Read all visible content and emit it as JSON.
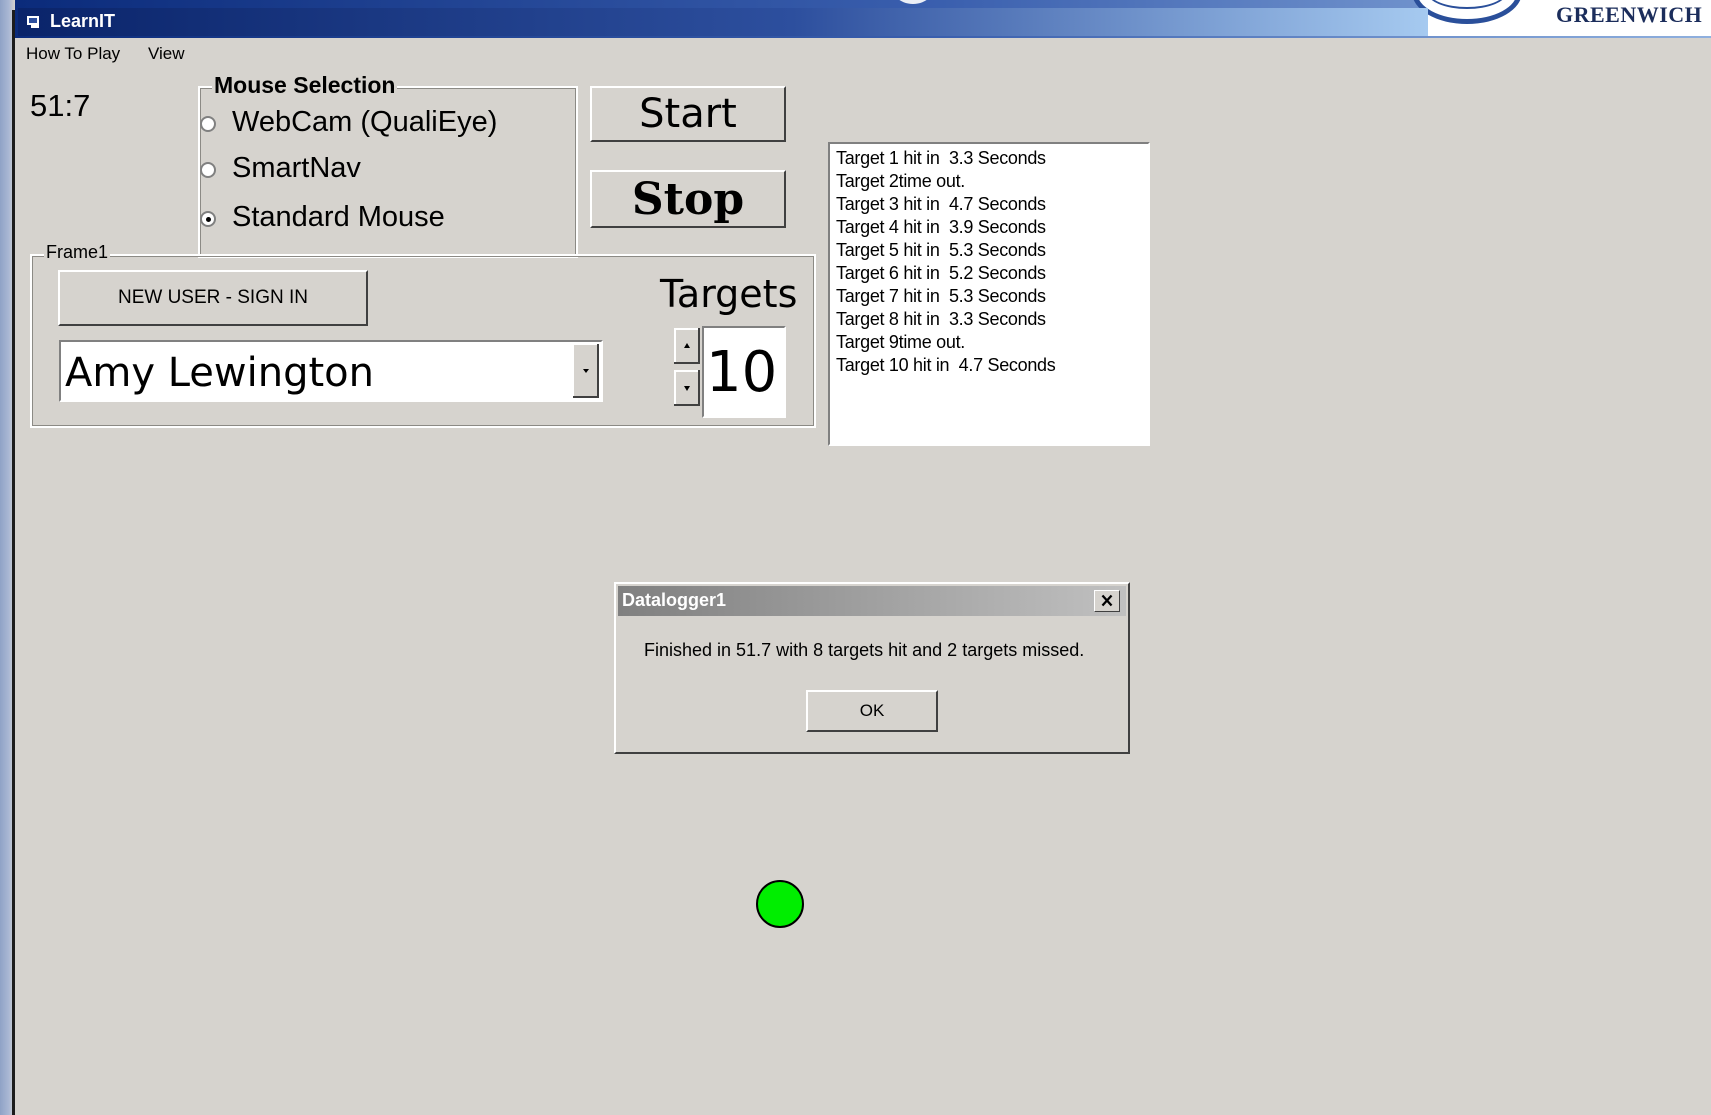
{
  "logo": {
    "text": "GREENWICH"
  },
  "window": {
    "title": "LearnIT"
  },
  "menu": {
    "items": [
      "How To Play",
      "View"
    ]
  },
  "timer": "51:7",
  "mouse_selection": {
    "label": "Mouse Selection",
    "options": [
      "WebCam (QualiEye)",
      "SmartNav",
      "Standard Mouse"
    ],
    "selected": "Standard Mouse"
  },
  "buttons": {
    "start": "Start",
    "stop": "Stop",
    "new_user": "NEW USER - SIGN IN"
  },
  "frame1": {
    "label": "Frame1"
  },
  "user_combo": {
    "value": "Amy Lewington"
  },
  "targets": {
    "label": "Targets",
    "value": "10"
  },
  "results": [
    "Target 1 hit in  3.3 Seconds",
    "Target 2time out.",
    "Target 3 hit in  4.7 Seconds",
    "Target 4 hit in  3.9 Seconds",
    "Target 5 hit in  5.3 Seconds",
    "Target 6 hit in  5.2 Seconds",
    "Target 7 hit in  5.3 Seconds",
    "Target 8 hit in  3.3 Seconds",
    "Target 9time out.",
    "Target 10 hit in  4.7 Seconds"
  ],
  "dialog": {
    "title": "Datalogger1",
    "message": "Finished in 51.7 with 8 targets hit and 2 targets missed.",
    "ok_label": "OK"
  },
  "colors": {
    "target_dot": "#00ee00",
    "title_bar": "#0a246a",
    "background": "#d6d3ce"
  }
}
